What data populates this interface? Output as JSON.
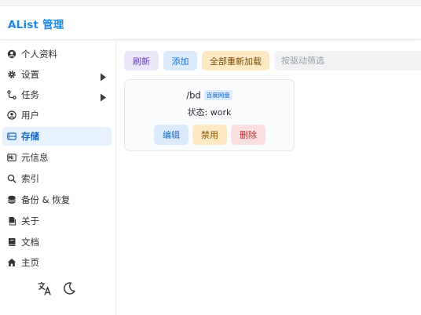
{
  "app": {
    "title": "AList 管理"
  },
  "sidebar": {
    "items": [
      {
        "label": "个人资料",
        "icon": "profile-icon",
        "has_submenu": false,
        "active": false
      },
      {
        "label": "设置",
        "icon": "gear-icon",
        "has_submenu": true,
        "active": false
      },
      {
        "label": "任务",
        "icon": "tasks-icon",
        "has_submenu": true,
        "active": false
      },
      {
        "label": "用户",
        "icon": "user-icon",
        "has_submenu": false,
        "active": false
      },
      {
        "label": "存储",
        "icon": "storage-icon",
        "has_submenu": false,
        "active": true
      },
      {
        "label": "元信息",
        "icon": "meta-icon",
        "has_submenu": false,
        "active": false
      },
      {
        "label": "索引",
        "icon": "search-icon",
        "has_submenu": false,
        "active": false
      },
      {
        "label": "备份 & 恢复",
        "icon": "database-icon",
        "has_submenu": false,
        "active": false
      },
      {
        "label": "关于",
        "icon": "about-icon",
        "has_submenu": false,
        "active": false
      },
      {
        "label": "文档",
        "icon": "book-icon",
        "has_submenu": false,
        "active": false
      },
      {
        "label": "主页",
        "icon": "home-icon",
        "has_submenu": false,
        "active": false
      }
    ],
    "bottom": {
      "language_icon": "translate-icon",
      "theme_icon": "moon-icon"
    }
  },
  "toolbar": {
    "refresh_label": "刷新",
    "add_label": "添加",
    "reload_label": "全部重新加载",
    "filter_placeholder": "按驱动筛选",
    "filter_value": ""
  },
  "storage": {
    "mount_path": "/bd",
    "driver_tag": "百度网盘",
    "status": "状态: work",
    "edit_label": "编辑",
    "disable_label": "禁用",
    "delete_label": "删除"
  },
  "colors": {
    "brand": "#1e88e5",
    "active_bg": "#e5f1fd",
    "refresh_bg": "#ece6fb",
    "add_bg": "#dcebfb",
    "reload_bg": "#fde9c4",
    "delete_bg": "#fbe0e0"
  }
}
